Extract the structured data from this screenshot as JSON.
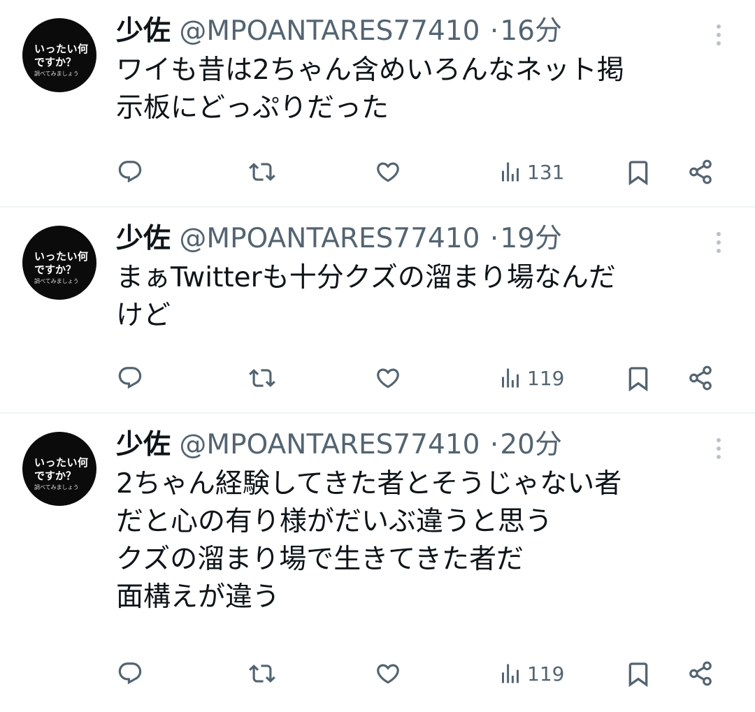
{
  "tweets": [
    {
      "avatar": {
        "line1": "いったい何",
        "line2": "ですか？",
        "line3": "調べてみましょう"
      },
      "name": "少佐",
      "handle": "@MPOANTARES77410",
      "separator": "·",
      "time": "16分",
      "text_lines": [
        "ワイも昔は2ちゃん含めいろんなネット掲",
        "示板にどっぷりだった"
      ],
      "views": "131"
    },
    {
      "avatar": {
        "line1": "いったい何",
        "line2": "ですか？",
        "line3": "調べてみましょう"
      },
      "name": "少佐",
      "handle": "@MPOANTARES77410",
      "separator": "·",
      "time": "19分",
      "text_lines": [
        "まぁTwitterも十分クズの溜まり場なんだ",
        "けど"
      ],
      "views": "119"
    },
    {
      "avatar": {
        "line1": "いったい何",
        "line2": "ですか？",
        "line3": "調べてみましょう"
      },
      "name": "少佐",
      "handle": "@MPOANTARES77410",
      "separator": "·",
      "time": "20分",
      "text_lines": [
        "2ちゃん経験してきた者とそうじゃない者",
        "だと心の有り様がだいぶ違うと思う",
        "クズの溜まり場で生きてきた者だ",
        "面構えが違う"
      ],
      "views": "119"
    }
  ],
  "icons": [
    "more-icon",
    "reply-icon",
    "retweet-icon",
    "like-icon",
    "views-icon",
    "bookmark-icon",
    "share-icon"
  ],
  "colors": {
    "text": "#0f1419",
    "secondary": "#536471",
    "divider": "#eff3f4",
    "avatar_bg": "#0b0b0b"
  }
}
